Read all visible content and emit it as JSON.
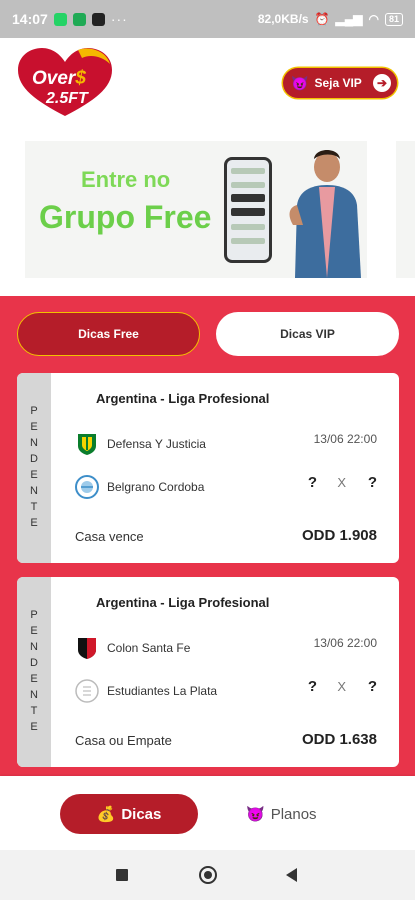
{
  "status_bar": {
    "time": "14:07",
    "dots": "···",
    "network": "82,0KB/s",
    "battery": "81"
  },
  "header": {
    "logo_line1_a": "Over",
    "logo_line1_b": "$",
    "logo_line2": "2.5FT",
    "vip_button_label": "Seja VIP",
    "vip_emoji": "😈",
    "vip_arrow": "➔"
  },
  "banner": {
    "line1": "Entre no",
    "line2": "Grupo Free"
  },
  "tabs": [
    {
      "label": "Dicas Free",
      "active": true
    },
    {
      "label": "Dicas VIP",
      "active": false
    }
  ],
  "cards": [
    {
      "status": [
        "P",
        "E",
        "N",
        "D",
        "E",
        "N",
        "T",
        "E"
      ],
      "league": "Argentina - Liga Profesional",
      "home_team": "Defensa Y Justicia",
      "away_team": "Belgrano Cordoba",
      "datetime": "13/06 22:00",
      "score_home": "?",
      "score_sep": "X",
      "score_away": "?",
      "market": "Casa vence",
      "odd": "ODD 1.908"
    },
    {
      "status": [
        "P",
        "E",
        "N",
        "D",
        "E",
        "N",
        "T",
        "E"
      ],
      "league": "Argentina - Liga Profesional",
      "home_team": "Colon Santa Fe",
      "away_team": "Estudiantes La Plata",
      "datetime": "13/06 22:00",
      "score_home": "?",
      "score_sep": "X",
      "score_away": "?",
      "market": "Casa ou Empate",
      "odd": "ODD 1.638"
    }
  ],
  "bottom_nav": {
    "dicas_label": "Dicas",
    "dicas_emoji": "💰",
    "planos_label": "Planos",
    "planos_emoji": "😈"
  },
  "colors": {
    "brand_red": "#b51d29",
    "background_red": "#e8344a",
    "accent_yellow": "#f2c200"
  }
}
